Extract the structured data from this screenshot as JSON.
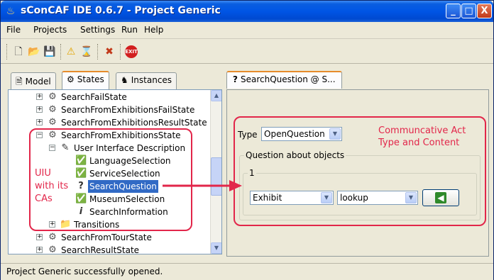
{
  "window": {
    "title": "sConCAF IDE 0.6.7 - Project Generic",
    "min_label": "_",
    "max_label": "□",
    "close_label": "X"
  },
  "menu": {
    "items": [
      "File",
      "Projects",
      "Settings",
      "Run",
      "Help"
    ]
  },
  "left_tabs": [
    {
      "label": "Model",
      "icon": "model-icon"
    },
    {
      "label": "States",
      "icon": "states-icon",
      "active": true
    },
    {
      "label": "Instances",
      "icon": "instances-icon"
    }
  ],
  "tree": {
    "rows": [
      {
        "label": "SearchFailState",
        "expander": "+"
      },
      {
        "label": "SearchFromExhibitionsFailState",
        "expander": "+"
      },
      {
        "label": "SearchFromExhibitionsResultState",
        "expander": "+"
      },
      {
        "label": "SearchFromExhibitionsState",
        "expander": "−"
      },
      {
        "label": "User Interface Description",
        "expander": "−"
      },
      {
        "label": "LanguageSelection"
      },
      {
        "label": "ServiceSelection"
      },
      {
        "label": "SearchQuestion",
        "selected": true
      },
      {
        "label": "MuseumSelection"
      },
      {
        "label": "SearchInformation"
      },
      {
        "label": "Transitions",
        "expander": "+"
      },
      {
        "label": "SearchFromTourState",
        "expander": "+"
      },
      {
        "label": "SearchResultState",
        "expander": "+"
      }
    ]
  },
  "right_tab": {
    "label": "SearchQuestion @ S..."
  },
  "form": {
    "type_label": "Type",
    "type_value": "OpenQuestion",
    "group_label": "Question about objects",
    "subgroup_label": "1",
    "object_value": "Exhibit",
    "action_value": "lookup"
  },
  "annotations": {
    "left": [
      "UIU",
      "with its",
      "CAs"
    ],
    "right": [
      "Communcative Act",
      "Type and Content"
    ]
  },
  "status": {
    "text": "Project Generic successfully opened."
  },
  "colors": {
    "annotation": "#e2264a",
    "selection": "#316ac5",
    "titlebar": "#0055e5"
  }
}
